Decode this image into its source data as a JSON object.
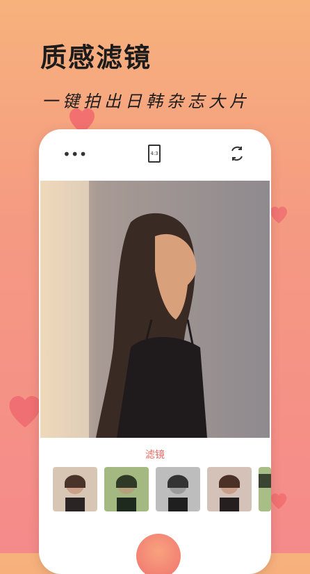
{
  "heading": "质感滤镜",
  "subheading": "一键拍出日韩杂志大片",
  "camera": {
    "more_icon": "more-dots-icon",
    "ratio_label": "4:3",
    "switch_icon": "switch-camera-icon"
  },
  "filter_section": {
    "title": "滤镜"
  },
  "filters": [
    {
      "name": "original",
      "tone": "#c7a58e"
    },
    {
      "name": "green",
      "tone": "#8fa86d"
    },
    {
      "name": "mono",
      "tone": "#9a9a9a"
    },
    {
      "name": "warm",
      "tone": "#c49b86"
    },
    {
      "name": "fresh",
      "tone": "#9fb67e"
    }
  ],
  "colors": {
    "accent": "#e36b62",
    "background_top": "#f7b27c",
    "background_bottom": "#f58a8a",
    "heart": "#ef6f72"
  }
}
